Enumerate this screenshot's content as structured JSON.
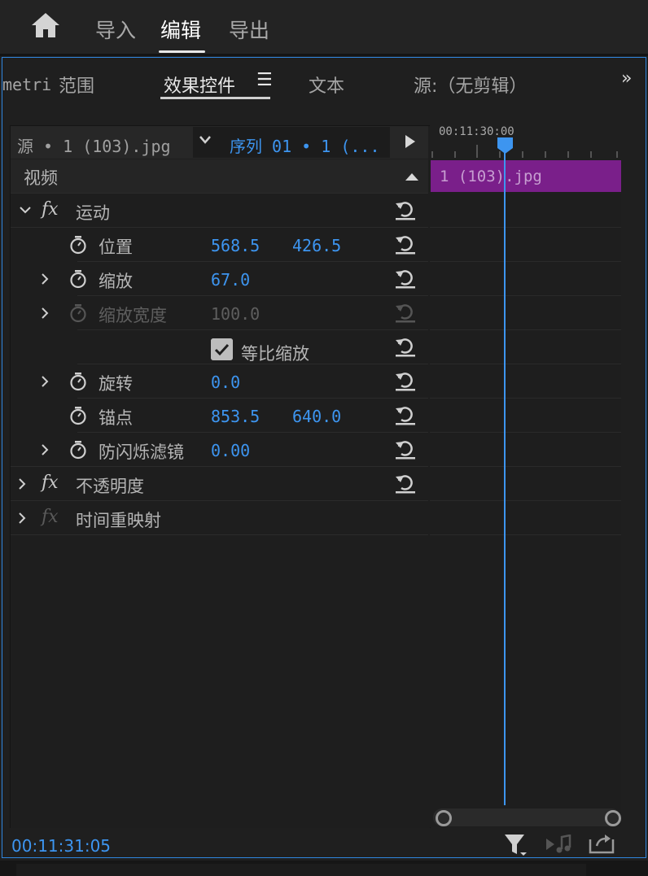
{
  "top_tabs": {
    "import": "导入",
    "edit": "编辑",
    "export": "导出"
  },
  "panel_tabs": {
    "lumetri": "metri",
    "scopes": "范围",
    "effect_controls": "效果控件",
    "menu_glyph": "☰",
    "text": "文本",
    "source": "源:（无剪辑）",
    "more": "»"
  },
  "source_bar": {
    "source": "源 • 1 (103).jpg",
    "sequence": "序列 01 • 1 (..."
  },
  "section": {
    "video": "视频"
  },
  "effects": {
    "motion": {
      "label": "运动",
      "position": {
        "label": "位置",
        "x": "568.5",
        "y": "426.5"
      },
      "scale": {
        "label": "缩放",
        "value": "67.0"
      },
      "scale_width": {
        "label": "缩放宽度",
        "value": "100.0"
      },
      "uniform_scale": {
        "label": "等比缩放",
        "checked": true
      },
      "rotation": {
        "label": "旋转",
        "value": "0.0"
      },
      "anchor": {
        "label": "锚点",
        "x": "853.5",
        "y": "640.0"
      },
      "anti_flicker": {
        "label": "防闪烁滤镜",
        "value": "0.00"
      }
    },
    "opacity": {
      "label": "不透明度"
    },
    "time_remap": {
      "label": "时间重映射"
    },
    "fx_glyph": "fx"
  },
  "timeline": {
    "ruler_time": "00:11:30:00",
    "clip_name": "1 (103).jpg"
  },
  "footer": {
    "timecode": "00:11:31:05"
  },
  "colors": {
    "accent": "#3d95f0",
    "clip": "#7a1f8a",
    "panel_border": "#2f86e0"
  }
}
